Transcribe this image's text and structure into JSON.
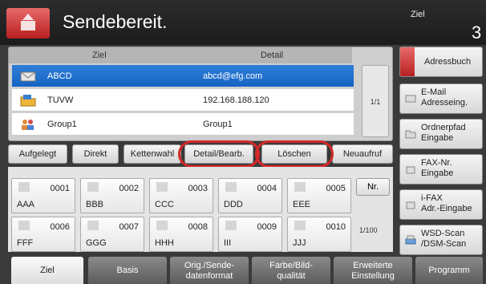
{
  "header": {
    "title": "Sendebereit.",
    "ziel_label": "Ziel",
    "ziel_count": "3"
  },
  "dest_list": {
    "col_ziel": "Ziel",
    "col_detail": "Detail",
    "rows": [
      {
        "name": "ABCD",
        "detail": "abcd@efg.com",
        "icon": "email-icon",
        "selected": true
      },
      {
        "name": "TUVW",
        "detail": "192.168.188.120",
        "icon": "folder-icon",
        "selected": false
      },
      {
        "name": "Group1",
        "detail": "Group1",
        "icon": "group-icon",
        "selected": false
      }
    ],
    "page": "1/1"
  },
  "right_buttons": {
    "adressbuch": "Adressbuch",
    "email_1": "E-Mail",
    "email_2": "Adresseing.",
    "ordner_1": "Ordnerpfad",
    "ordner_2": "Eingabe",
    "fax_1": "FAX-Nr.",
    "fax_2": "Eingabe",
    "ifax_1": "i-FAX",
    "ifax_2": "Adr.-Eingabe",
    "wsd_1": "WSD-Scan",
    "wsd_2": "/DSM-Scan"
  },
  "toolbar": {
    "aufgelegt": "Aufgelegt",
    "direkt": "Direkt",
    "kettenwahl": "Kettenwahl",
    "detail": "Detail/Bearb.",
    "loeschen": "Löschen",
    "neuaufruf": "Neuaufruf"
  },
  "one_touch": [
    {
      "num": "0001",
      "name": "AAA"
    },
    {
      "num": "0002",
      "name": "BBB"
    },
    {
      "num": "0003",
      "name": "CCC"
    },
    {
      "num": "0004",
      "name": "DDD"
    },
    {
      "num": "0005",
      "name": "EEE"
    },
    {
      "num": "0006",
      "name": "FFF"
    },
    {
      "num": "0007",
      "name": "GGG"
    },
    {
      "num": "0008",
      "name": "HHH"
    },
    {
      "num": "0009",
      "name": "III"
    },
    {
      "num": "0010",
      "name": "JJJ"
    }
  ],
  "nr_button": "Nr.",
  "key_page": "1/100",
  "tabs": {
    "ziel": "Ziel",
    "basis": "Basis",
    "orig_1": "Orig./Sende-",
    "orig_2": "datenformat",
    "farbe_1": "Farbe/Bild-",
    "farbe_2": "qualität",
    "erw_1": "Erweiterte",
    "erw_2": "Einstellung",
    "programm": "Programm"
  },
  "colors": {
    "accent_red": "#c62828",
    "selection_blue": "#1a6ccc",
    "highlight_oval": "#d62828"
  }
}
